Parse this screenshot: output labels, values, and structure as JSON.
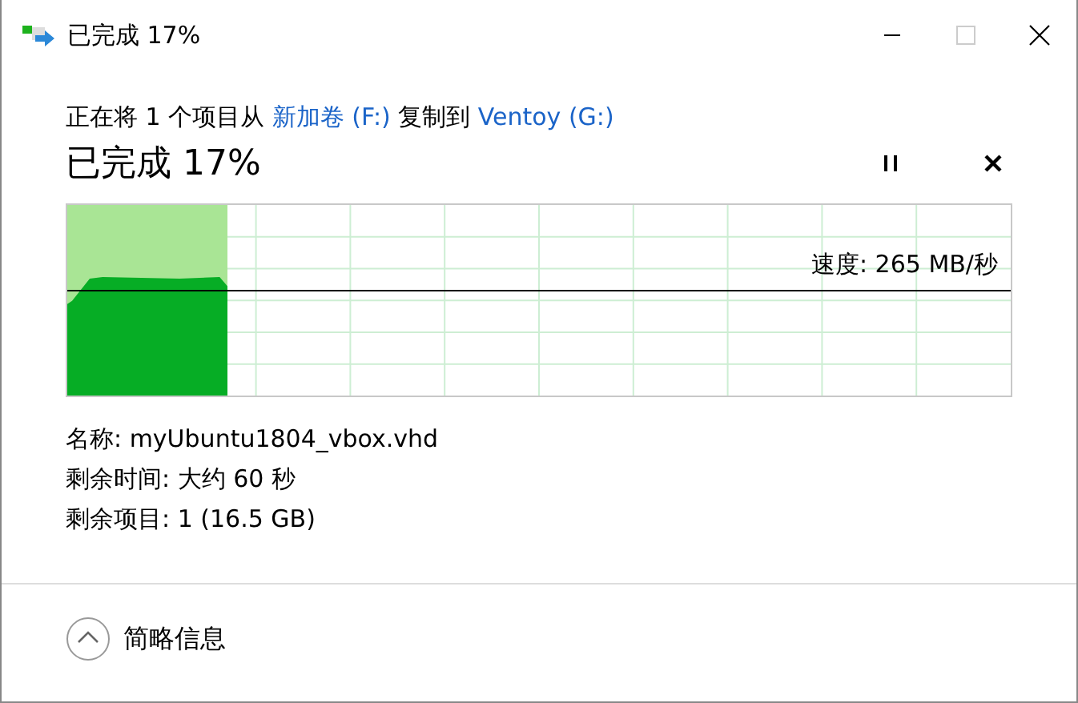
{
  "window": {
    "title": "已完成 17%"
  },
  "description": [
    {
      "kind": "text",
      "text": "正在将 1 个项目从 "
    },
    {
      "kind": "link",
      "text": "新加卷 (F:)"
    },
    {
      "kind": "text",
      "text": " 复制到 "
    },
    {
      "kind": "link",
      "text": "Ventoy (G:)"
    }
  ],
  "status": "已完成 17%",
  "progress": {
    "level": 0.17,
    "speed": "速度: 265 MB/秒"
  },
  "details": [
    "名称: myUbuntu1804_vbox.vhd",
    "剩余时间: 大约 60 秒",
    "剩余项目: 1 (16.5 GB)"
  ],
  "toggle": {
    "label": "简略信息",
    "expanded": true
  }
}
